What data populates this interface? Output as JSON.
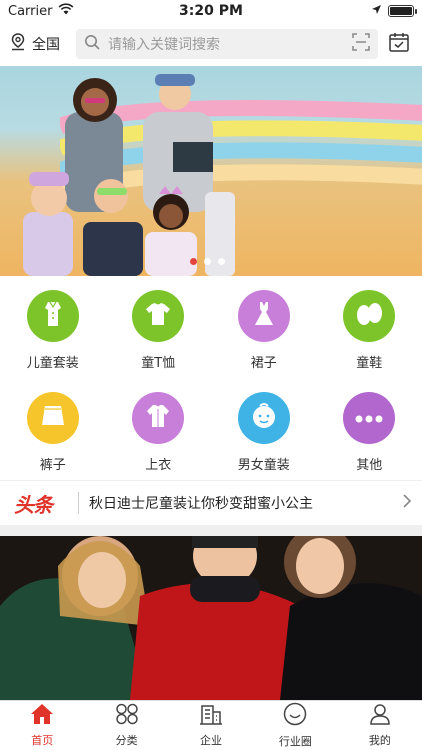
{
  "status_bar": {
    "carrier": "Carrier",
    "time": "3:20 PM",
    "battery_level": 1.0
  },
  "header": {
    "location_label": "全国",
    "search_placeholder": "请输入关键词搜索"
  },
  "banner": {
    "slide_count": 3,
    "active_slide": 1
  },
  "categories": [
    {
      "label": "儿童套装",
      "icon": "kids-suit-icon",
      "color": "#7cc42a"
    },
    {
      "label": "童T恤",
      "icon": "tshirt-icon",
      "color": "#7cc42a"
    },
    {
      "label": "裙子",
      "icon": "dress-icon",
      "color": "#c77fd9"
    },
    {
      "label": "童鞋",
      "icon": "shoes-icon",
      "color": "#7cc42a"
    },
    {
      "label": "裤子",
      "icon": "pants-icon",
      "color": "#f6c52b"
    },
    {
      "label": "上衣",
      "icon": "top-icon",
      "color": "#c77fd9"
    },
    {
      "label": "男女童装",
      "icon": "baby-face-icon",
      "color": "#3fb3e6"
    },
    {
      "label": "其他",
      "icon": "more-icon",
      "color": "#b267cf"
    }
  ],
  "headline": {
    "tag": "头条",
    "text": "秋日迪士尼童装让你秒变甜蜜小公主"
  },
  "tabs": [
    {
      "label": "首页",
      "icon": "home-icon",
      "active": true
    },
    {
      "label": "分类",
      "icon": "category-icon",
      "active": false
    },
    {
      "label": "企业",
      "icon": "building-icon",
      "active": false
    },
    {
      "label": "行业圈",
      "icon": "circle-smile-icon",
      "active": false
    },
    {
      "label": "我的",
      "icon": "user-icon",
      "active": false
    }
  ],
  "colors": {
    "accent": "#e0332a"
  }
}
